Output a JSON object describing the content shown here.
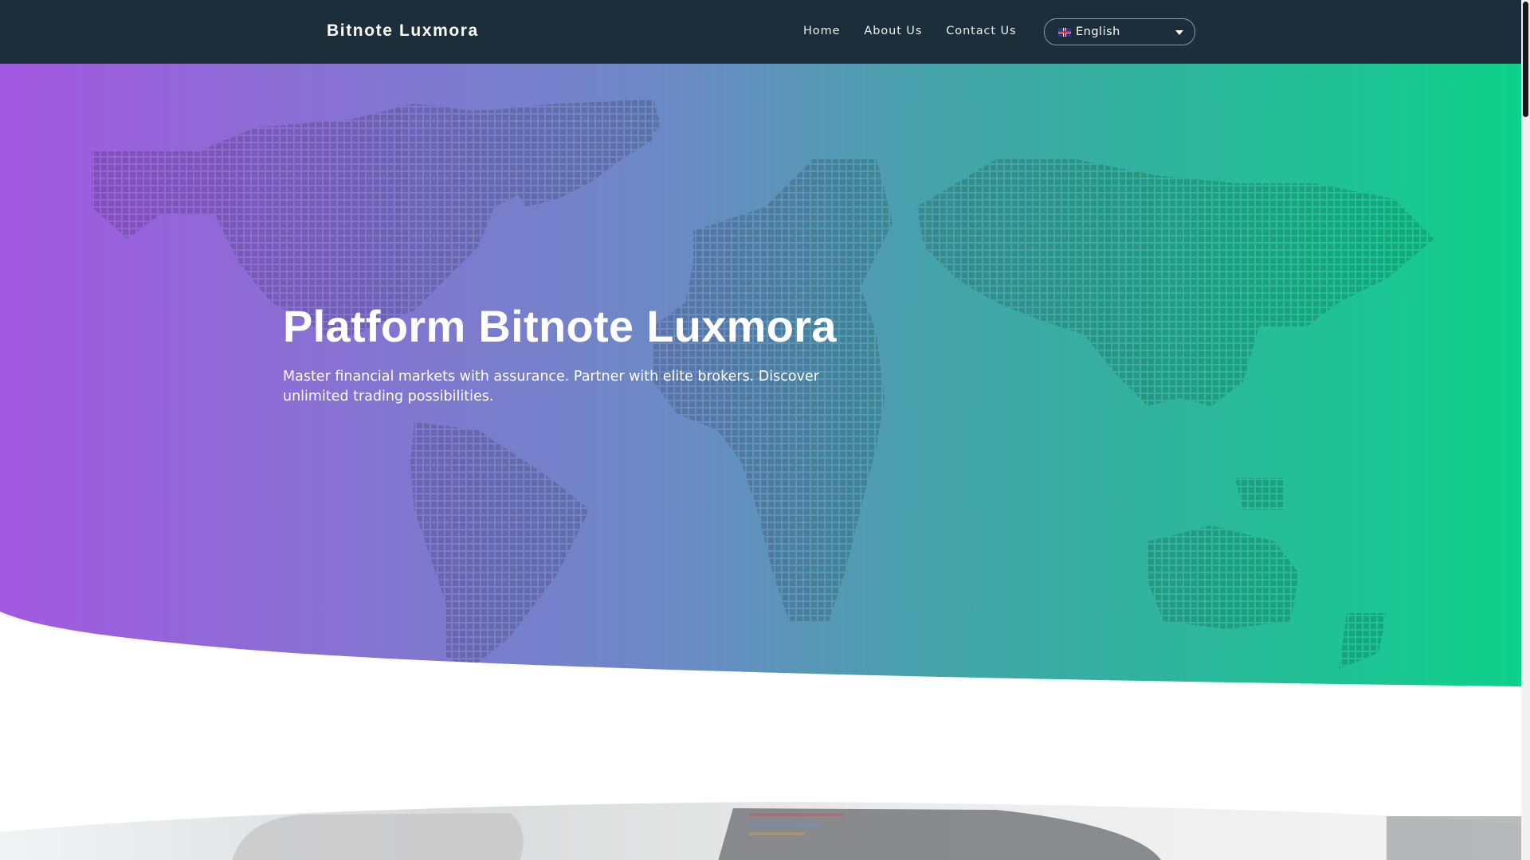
{
  "navbar": {
    "brand": "Bitnote Luxmora",
    "links": [
      "Home",
      "About Us",
      "Contact Us"
    ],
    "language": {
      "selected": "English",
      "flag_icon": "uk-flag-icon"
    }
  },
  "hero": {
    "title": "Platform Bitnote Luxmora",
    "subtitle": "Master financial markets with assurance. Partner with elite brokers. Discover unlimited trading possibilities.",
    "gradient": {
      "from": "#a259e0",
      "mid": "#5b8fbd",
      "to": "#0ed18a"
    }
  },
  "colors": {
    "navbar_bg": "#1b2e3a",
    "white": "#ffffff"
  }
}
